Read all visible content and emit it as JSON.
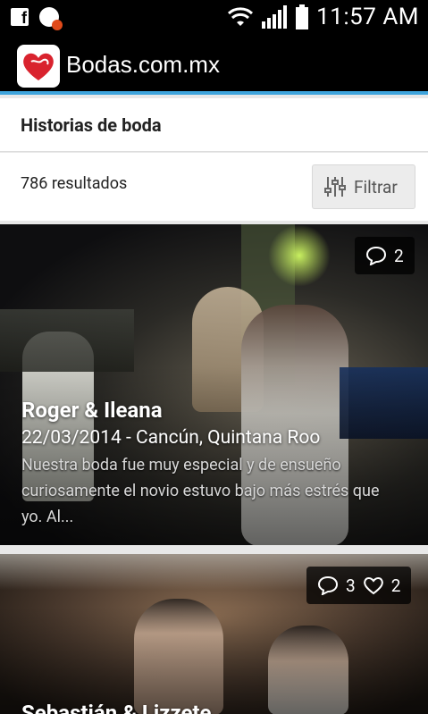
{
  "status_bar": {
    "time": "11:57 AM",
    "icons": [
      "facebook-icon",
      "app-notification-icon",
      "wifi-icon",
      "signal-icon",
      "battery-icon"
    ]
  },
  "app_bar": {
    "title": "Bodas.com.mx",
    "logo": "heart-logo-icon"
  },
  "section": {
    "title": "Historias de boda"
  },
  "results": {
    "count_label": "786 resultados",
    "filter_label": "Filtrar"
  },
  "cards": [
    {
      "name": "Roger & Ileana",
      "meta": "22/03/2014 - Cancún, Quintana Roo",
      "description": "Nuestra boda fue muy especial y de ensueño curiosamente el novio estuvo bajo más estrés que yo. Al...",
      "comments": "2"
    },
    {
      "name": "Sebastián & Lizzete",
      "comments": "3",
      "likes": "2"
    }
  ],
  "colors": {
    "accent": "#3ea4dc",
    "logo_heart": "#d9232e"
  }
}
